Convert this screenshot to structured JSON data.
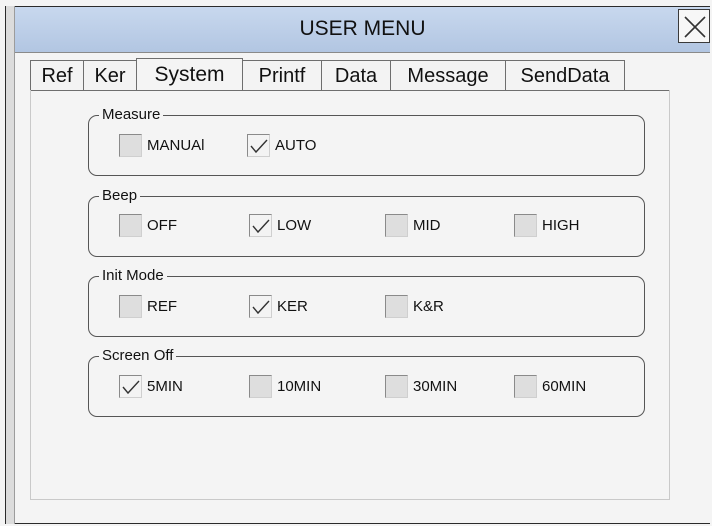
{
  "window": {
    "title": "USER MENU"
  },
  "tabs": [
    {
      "label": "Ref"
    },
    {
      "label": "Ker"
    },
    {
      "label": "System",
      "active": true
    },
    {
      "label": "Printf"
    },
    {
      "label": "Data"
    },
    {
      "label": "Message"
    },
    {
      "label": "SendData"
    }
  ],
  "groups": {
    "measure": {
      "title": "Measure",
      "options": [
        {
          "label": "MANUAl",
          "checked": false
        },
        {
          "label": "AUTO",
          "checked": true
        }
      ]
    },
    "beep": {
      "title": "Beep",
      "options": [
        {
          "label": "OFF",
          "checked": false
        },
        {
          "label": "LOW",
          "checked": true
        },
        {
          "label": "MID",
          "checked": false
        },
        {
          "label": "HIGH",
          "checked": false
        }
      ]
    },
    "init_mode": {
      "title": "Init Mode",
      "options": [
        {
          "label": "REF",
          "checked": false
        },
        {
          "label": "KER",
          "checked": true
        },
        {
          "label": "K&R",
          "checked": false
        }
      ]
    },
    "screen_off": {
      "title": "Screen Off",
      "options": [
        {
          "label": "5MIN",
          "checked": true
        },
        {
          "label": "10MIN",
          "checked": false
        },
        {
          "label": "30MIN",
          "checked": false
        },
        {
          "label": "60MIN",
          "checked": false
        }
      ]
    }
  },
  "icons": {
    "close": "close-icon",
    "check": "checkmark-icon"
  },
  "colors": {
    "titlebar": "#b8cbe6",
    "background": "#f4f4f4"
  }
}
